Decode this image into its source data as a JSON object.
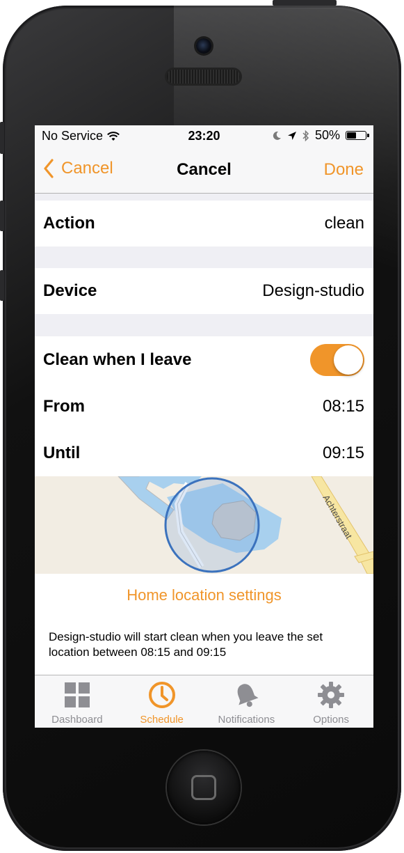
{
  "status_bar": {
    "carrier": "No Service",
    "time": "23:20",
    "battery": "50%",
    "battery_level": 0.5
  },
  "nav": {
    "back_label": "Cancel",
    "title": "Cancel",
    "done_label": "Done"
  },
  "rows": {
    "action": {
      "label": "Action",
      "value": "clean"
    },
    "device": {
      "label": "Device",
      "value": "Design-studio"
    },
    "clean_when_leave": {
      "label": "Clean when I leave",
      "toggle_on": true
    },
    "from": {
      "label": "From",
      "value": "08:15"
    },
    "until": {
      "label": "Until",
      "value": "09:15"
    }
  },
  "map": {
    "street_label": "Achterstraat"
  },
  "home_location_link": "Home location settings",
  "description": "Design-studio will start clean when you leave the set location between 08:15 and 09:15",
  "tabs": [
    {
      "label": "Dashboard",
      "icon": "dashboard-grid-icon",
      "active": false
    },
    {
      "label": "Schedule",
      "icon": "clock-icon",
      "active": true
    },
    {
      "label": "Notifications",
      "icon": "bell-icon",
      "active": false
    },
    {
      "label": "Options",
      "icon": "gear-icon",
      "active": false
    }
  ],
  "colors": {
    "accent": "#f0952a",
    "inactive": "#8e8e93",
    "map_water": "#a8d0ee",
    "map_circle": "#3b72bd"
  }
}
